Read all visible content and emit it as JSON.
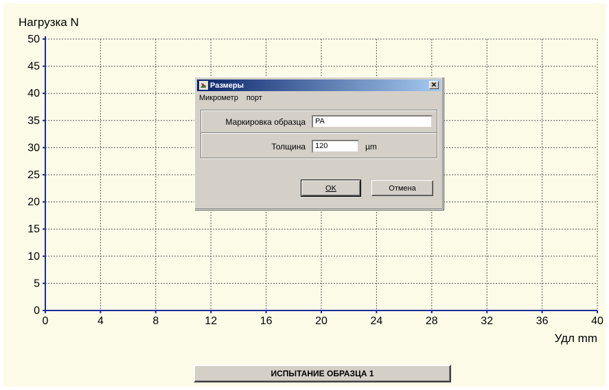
{
  "chart_data": {
    "type": "line",
    "title": "",
    "ylabel": "Нагрузка N",
    "xlabel": "Удл mm",
    "xlim": [
      0,
      40
    ],
    "ylim": [
      0,
      50
    ],
    "xticks": [
      0,
      4,
      8,
      12,
      16,
      20,
      24,
      28,
      32,
      36,
      40
    ],
    "yticks": [
      0,
      5,
      10,
      15,
      20,
      25,
      30,
      35,
      40,
      45,
      50
    ],
    "grid": true,
    "grid_style": "dotted",
    "series": [],
    "axis_color": "#1a2a9a"
  },
  "dialog": {
    "title": "Размеры",
    "close_label": "✕",
    "menu": [
      "Микрометр",
      "порт"
    ],
    "fields": {
      "marking_label": "Маркировка образца",
      "marking_value": "PA",
      "thickness_label": "Толщина",
      "thickness_value": "120",
      "thickness_unit": "µm"
    },
    "ok_label": "OK",
    "cancel_label": "Отмена"
  },
  "footer": {
    "test_button_label": "ИСПЫТАНИЕ ОБРАЗЦА 1"
  },
  "colors": {
    "background": "#fbfbe8",
    "titlebar": "#0a246a",
    "dialog": "#d4d0c8"
  }
}
